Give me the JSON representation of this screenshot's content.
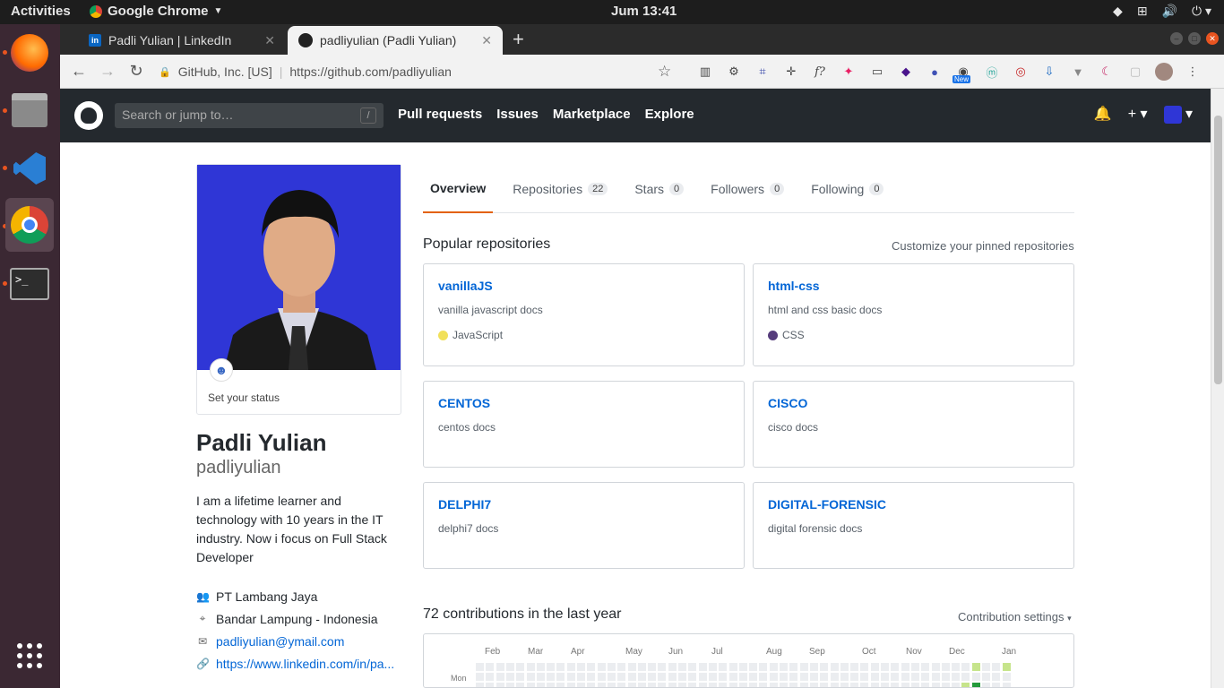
{
  "topbar": {
    "activities": "Activities",
    "app_name": "Google Chrome",
    "clock": "Jum 13:41"
  },
  "browser": {
    "tabs": [
      {
        "title": "Padli Yulian | LinkedIn",
        "active": false
      },
      {
        "title": "padliyulian (Padli Yulian)",
        "active": true
      }
    ],
    "new_tab": "+",
    "security_label": "GitHub, Inc. [US]",
    "url": "https://github.com/padliyulian",
    "extension_badge": "New"
  },
  "github": {
    "search_placeholder": "Search or jump to…",
    "search_shortcut": "/",
    "nav": [
      "Pull requests",
      "Issues",
      "Marketplace",
      "Explore"
    ]
  },
  "profile": {
    "set_status": "Set your status",
    "full_name": "Padli Yulian",
    "username": "padliyulian",
    "bio": "I am a lifetime learner and technology with 10 years in the IT industry. Now i focus on Full Stack Developer",
    "company": "PT Lambang Jaya",
    "location": "Bandar Lampung - Indonesia",
    "email": "padliyulian@ymail.com",
    "website": "https://www.linkedin.com/in/pa..."
  },
  "tabs": [
    {
      "label": "Overview",
      "count": null,
      "selected": true
    },
    {
      "label": "Repositories",
      "count": "22",
      "selected": false
    },
    {
      "label": "Stars",
      "count": "0",
      "selected": false
    },
    {
      "label": "Followers",
      "count": "0",
      "selected": false
    },
    {
      "label": "Following",
      "count": "0",
      "selected": false
    }
  ],
  "popular": {
    "title": "Popular repositories",
    "customize": "Customize your pinned repositories",
    "repos": [
      {
        "name": "vanillaJS",
        "desc": "vanilla javascript docs",
        "lang": "JavaScript",
        "lang_color": "#f1e05a"
      },
      {
        "name": "html-css",
        "desc": "html and css basic docs",
        "lang": "CSS",
        "lang_color": "#563d7c"
      },
      {
        "name": "CENTOS",
        "desc": "centos docs",
        "lang": "",
        "lang_color": ""
      },
      {
        "name": "CISCO",
        "desc": "cisco docs",
        "lang": "",
        "lang_color": ""
      },
      {
        "name": "DELPHI7",
        "desc": "delphi7 docs",
        "lang": "",
        "lang_color": ""
      },
      {
        "name": "DIGITAL-FORENSIC",
        "desc": "digital forensic docs",
        "lang": "",
        "lang_color": ""
      }
    ]
  },
  "contributions": {
    "title": "72 contributions in the last year",
    "settings": "Contribution settings",
    "months": [
      "Feb",
      "Mar",
      "Apr",
      "May",
      "Jun",
      "Jul",
      "Aug",
      "Sep",
      "Oct",
      "Nov",
      "Dec",
      "Jan"
    ],
    "day_label": "Mon",
    "colors": {
      "empty": "#ebedf0",
      "light": "#c6e48b",
      "dark": "#239a3b"
    }
  }
}
